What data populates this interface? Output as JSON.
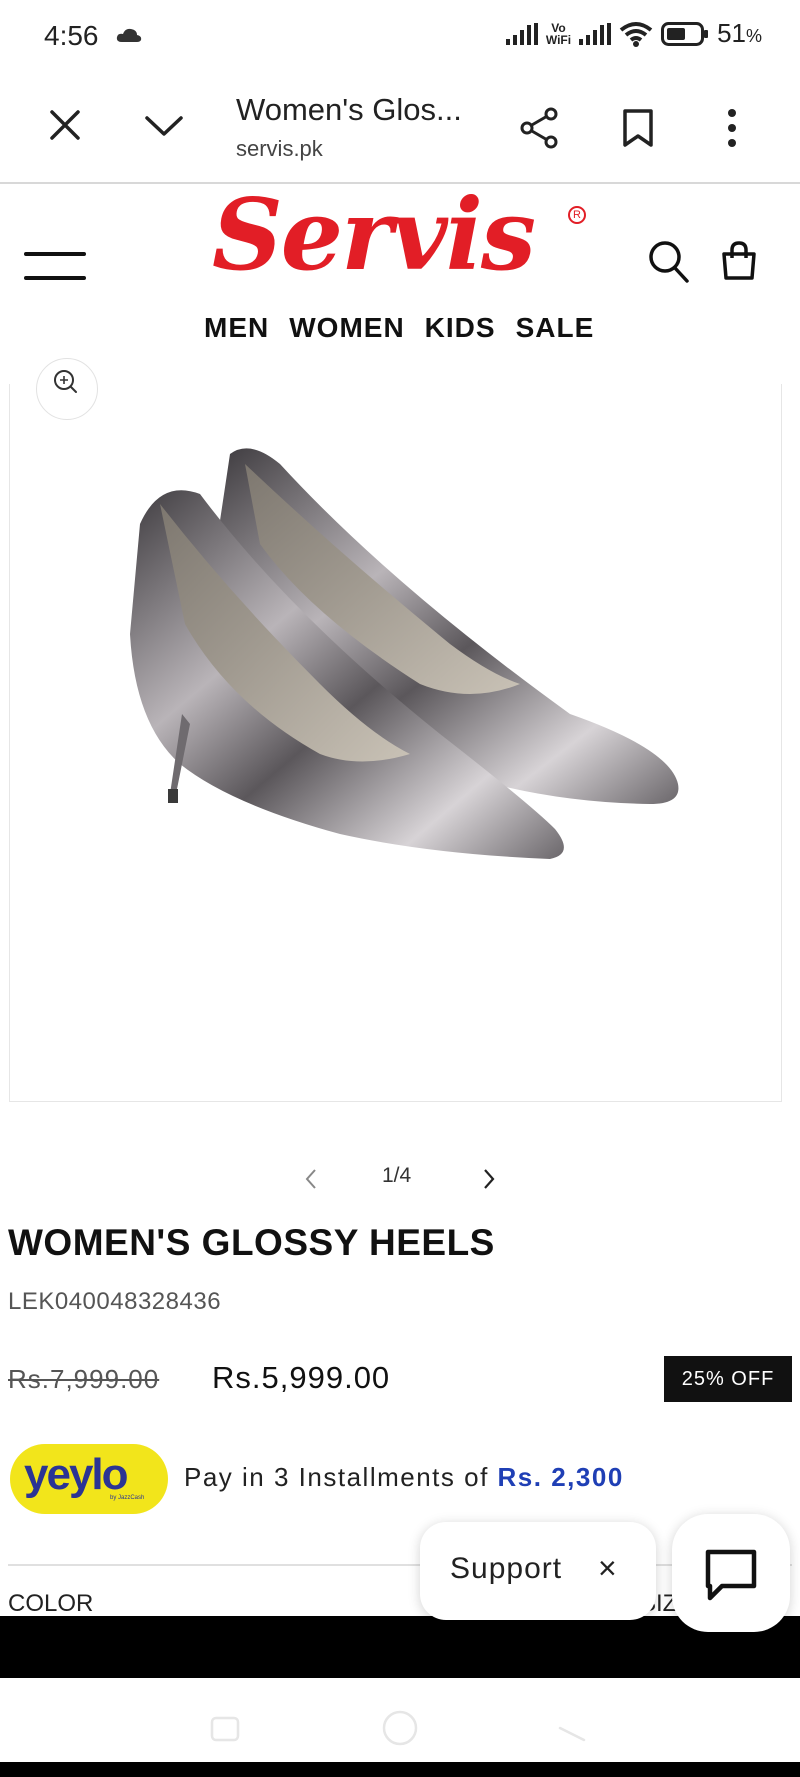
{
  "status_bar": {
    "time": "4:56",
    "vo_label": "Vo",
    "wifi_label": "WiFi",
    "battery_percent": "51",
    "percent_sign": "%"
  },
  "tab_bar": {
    "title": "Women's Glos...",
    "url": "servis.pk"
  },
  "site": {
    "logo": "Servis",
    "nav": [
      "MEN",
      "WOMEN",
      "KIDS",
      "SALE"
    ]
  },
  "gallery": {
    "pager": "1/4"
  },
  "product": {
    "title": "WOMEN'S GLOSSY HEELS",
    "sku": "LEK040048328436",
    "old_price": "Rs.7,999.00",
    "new_price": "Rs.5,999.00",
    "discount": "25% OFF"
  },
  "installments": {
    "brand": "yeylo",
    "brand_sub": "by JazzCash",
    "text": "Pay in 3 Installments of ",
    "amount": "Rs. 2,300"
  },
  "options": {
    "color_label": "COLOR",
    "size_label": "SIZ"
  },
  "support": {
    "label": "Support",
    "close": "×"
  },
  "colors": {
    "brand_red": "#e21e26",
    "yeylo_yellow": "#f2e51b",
    "yeylo_blue": "#2b3494",
    "installment_blue": "#1f3fb5"
  }
}
